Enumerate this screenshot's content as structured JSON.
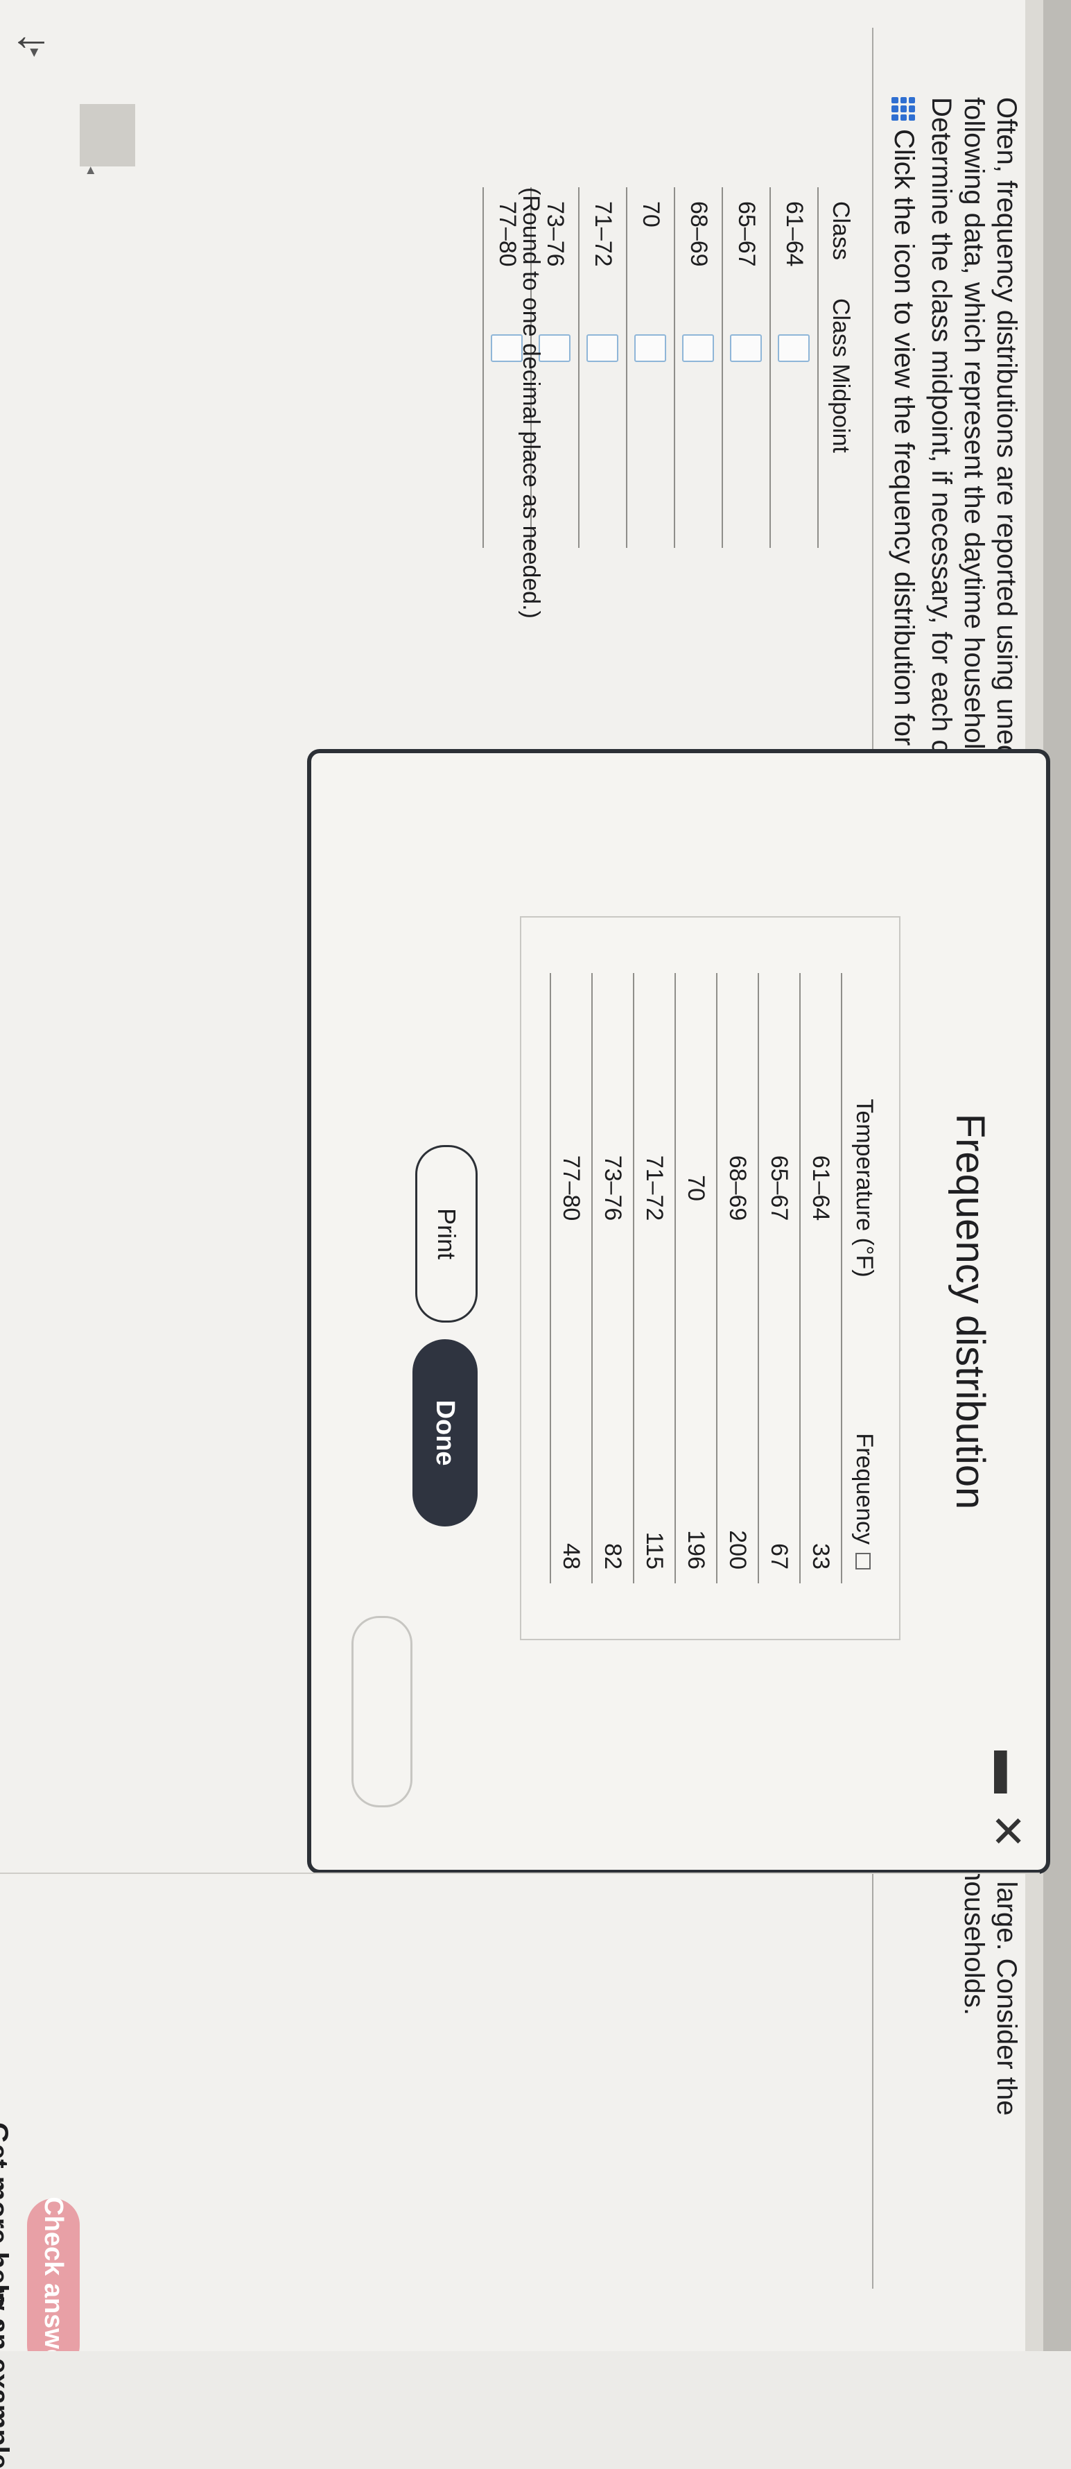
{
  "question": {
    "lines": [
      "Often, frequency distributions are reported using unequal class widths because the frequencies of some groups would otherwise be small or very large. Consider the",
      "following data, which represent the daytime household temperature the thermostat is set to when someone is home for a random sample of 741 households.",
      "Determine the class midpoint, if necessary, for each class and approximate the mean and standard deviation temperature."
    ],
    "icon_link": "Click the icon to view the frequency distribution for the daytime household temperature."
  },
  "class_table": {
    "headers": [
      "Class",
      "Class Midpoint"
    ],
    "rows": [
      "61–64",
      "65–67",
      "68–69",
      "70",
      "71–72",
      "73–76",
      "77–80"
    ],
    "note": "(Round to one decimal place as needed.)"
  },
  "dialog": {
    "title": "Frequency distribution",
    "close_glyph": "✕",
    "minimize_glyph": "▬",
    "headers": [
      "Temperature (°F)",
      "Frequency"
    ],
    "rows": [
      {
        "temp": "61–64",
        "freq": "33"
      },
      {
        "temp": "65–67",
        "freq": "67"
      },
      {
        "temp": "68–69",
        "freq": "200"
      },
      {
        "temp": "70",
        "freq": "196"
      },
      {
        "temp": "71–72",
        "freq": "115"
      },
      {
        "temp": "73–76",
        "freq": "82"
      },
      {
        "temp": "77–80",
        "freq": "48"
      }
    ],
    "print_label": "Print",
    "done_label": "Done"
  },
  "footer": {
    "example_label": "w an example",
    "help_label": "Get more help ▴",
    "check_label": "Check answer"
  },
  "colors": {
    "done_bg": "#2f3440",
    "check_bg": "#e8a0a6",
    "icon_blue": "#2f6fd1"
  }
}
